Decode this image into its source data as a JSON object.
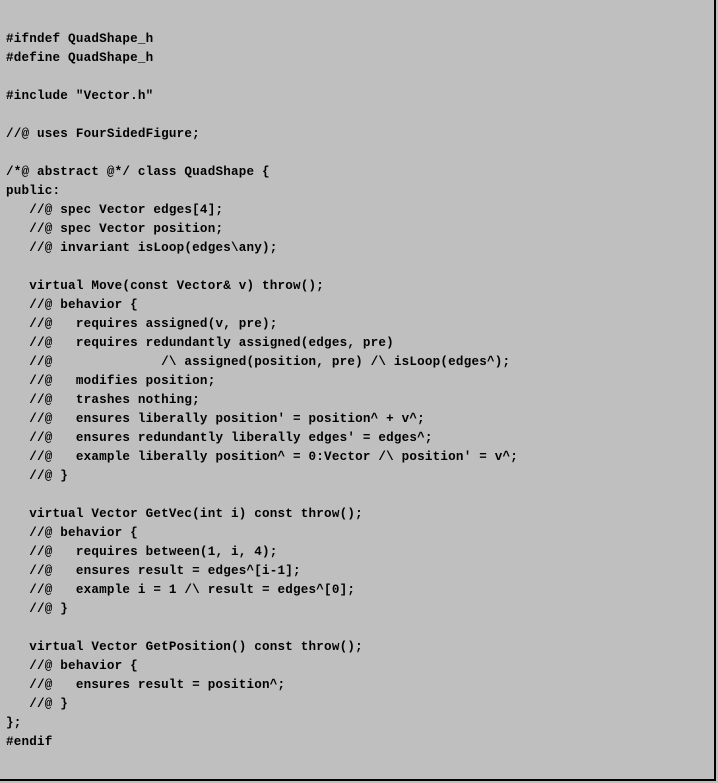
{
  "code": {
    "lines": [
      {
        "bold": true,
        "text": "#ifndef QuadShape_h"
      },
      {
        "bold": true,
        "text": "#define QuadShape_h"
      },
      {
        "bold": false,
        "text": ""
      },
      {
        "bold": true,
        "text": "#include \"Vector.h\""
      },
      {
        "bold": false,
        "text": ""
      },
      {
        "bold": true,
        "text": "//@ uses FourSidedFigure;"
      },
      {
        "bold": false,
        "text": ""
      },
      {
        "bold": true,
        "text": "/*@ abstract @*/ class QuadShape {"
      },
      {
        "bold": true,
        "text": "public:"
      },
      {
        "bold": true,
        "text": "   //@ spec Vector edges[4];"
      },
      {
        "bold": true,
        "text": "   //@ spec Vector position;"
      },
      {
        "bold": true,
        "text": "   //@ invariant isLoop(edges\\any);"
      },
      {
        "bold": false,
        "text": ""
      },
      {
        "bold": true,
        "text": "   virtual Move(const Vector& v) throw();"
      },
      {
        "bold": true,
        "text": "   //@ behavior {"
      },
      {
        "bold": true,
        "text": "   //@   requires assigned(v, pre);"
      },
      {
        "bold": true,
        "text": "   //@   requires redundantly assigned(edges, pre)"
      },
      {
        "bold": true,
        "text": "   //@              /\\ assigned(position, pre) /\\ isLoop(edges^);"
      },
      {
        "bold": true,
        "text": "   //@   modifies position;"
      },
      {
        "bold": true,
        "text": "   //@   trashes nothing;"
      },
      {
        "bold": true,
        "text": "   //@   ensures liberally position' = position^ + v^;"
      },
      {
        "bold": true,
        "text": "   //@   ensures redundantly liberally edges' = edges^;"
      },
      {
        "bold": true,
        "text": "   //@   example liberally position^ = 0:Vector /\\ position' = v^;"
      },
      {
        "bold": true,
        "text": "   //@ }"
      },
      {
        "bold": false,
        "text": ""
      },
      {
        "bold": true,
        "text": "   virtual Vector GetVec(int i) const throw();"
      },
      {
        "bold": true,
        "text": "   //@ behavior {"
      },
      {
        "bold": true,
        "text": "   //@   requires between(1, i, 4);"
      },
      {
        "bold": true,
        "text": "   //@   ensures result = edges^[i-1];"
      },
      {
        "bold": true,
        "text": "   //@   example i = 1 /\\ result = edges^[0];"
      },
      {
        "bold": true,
        "text": "   //@ }"
      },
      {
        "bold": false,
        "text": ""
      },
      {
        "bold": true,
        "text": "   virtual Vector GetPosition() const throw();"
      },
      {
        "bold": true,
        "text": "   //@ behavior {"
      },
      {
        "bold": true,
        "text": "   //@   ensures result = position^;"
      },
      {
        "bold": true,
        "text": "   //@ }"
      },
      {
        "bold": true,
        "text": "};"
      },
      {
        "bold": true,
        "text": "#endif"
      }
    ]
  }
}
